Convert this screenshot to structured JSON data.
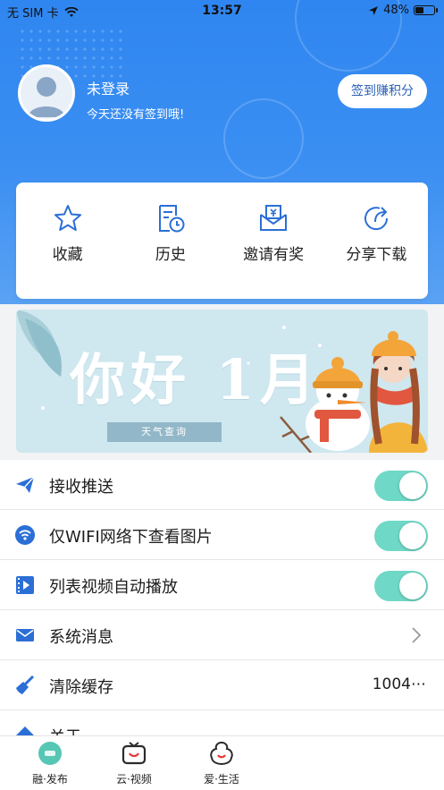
{
  "status_bar": {
    "carrier": "无 SIM 卡",
    "time": "13:57",
    "battery": "48%",
    "battery_level": 0.48
  },
  "profile": {
    "name": "未登录",
    "subtitle": "今天还没有签到哦!",
    "checkin_label": "签到赚积分"
  },
  "quick_actions": [
    {
      "label": "收藏",
      "icon": "star-icon"
    },
    {
      "label": "历史",
      "icon": "history-icon"
    },
    {
      "label": "邀请有奖",
      "icon": "invite-envelope-icon"
    },
    {
      "label": "分享下载",
      "icon": "share-icon"
    }
  ],
  "banner": {
    "title": "你好 1月",
    "button": "天气查询"
  },
  "settings": [
    {
      "label": "接收推送",
      "icon": "paper-plane-icon",
      "control": "toggle",
      "on": true
    },
    {
      "label": "仅WIFI网络下查看图片",
      "icon": "wifi-icon",
      "control": "toggle",
      "on": true
    },
    {
      "label": "列表视频自动播放",
      "icon": "video-film-icon",
      "control": "toggle",
      "on": true
    },
    {
      "label": "系统消息",
      "icon": "mail-icon",
      "control": "chevron"
    },
    {
      "label": "清除缓存",
      "icon": "broom-icon",
      "control": "value",
      "value": "1004⋯"
    },
    {
      "label": "关于",
      "icon": "info-icon",
      "control": "none"
    }
  ],
  "tabbar": [
    {
      "label": "融·发布",
      "icon": "home-icon"
    },
    {
      "label": "云·视频",
      "icon": "tv-icon"
    },
    {
      "label": "爱·生活",
      "icon": "life-icon"
    }
  ],
  "colors": {
    "header_blue": "#3b8ff2",
    "toggle_on": "#6fd8c6",
    "icon_blue": "#2b6fd6"
  }
}
